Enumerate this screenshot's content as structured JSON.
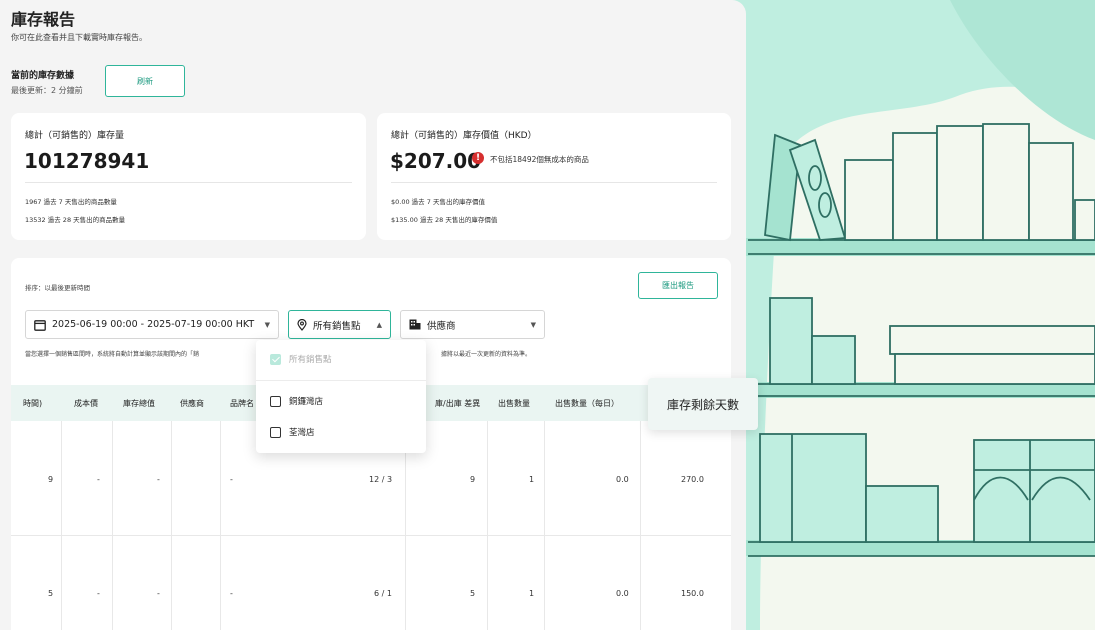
{
  "header": {
    "title": "庫存報告",
    "subtitle": "你可在此查看并且下載實時庫存報告。"
  },
  "current": {
    "title": "當前的庫存數據",
    "updated": "最後更新：2 分鐘前",
    "refresh_label": "刷新"
  },
  "card_quantity": {
    "label": "總計（可銷售的）庫存量",
    "value": "101278941",
    "line1": "1967  過去 7 天售出的商品數量",
    "line2": "13532  過去 28 天售出的商品數量"
  },
  "card_value": {
    "label": "總計（可銷售的）庫存價值（HKD）",
    "value": "$207.00",
    "warning_icon": "!",
    "warning": "不包括18492個無成本的商品",
    "line1": "$0.00  過去 7 天售出的庫存價值",
    "line2": "$135.00  過去 28 天售出的庫存價值"
  },
  "filters": {
    "sort_text": "排序：以最後更新時間",
    "export_label": "匯出報告",
    "date_range": "2025-06-19 00:00 - 2025-07-19 00:00  HKT",
    "location": "所有銷售點",
    "supplier": "供應商",
    "hint_left": "當您選擇一個銷售區間時，系統將自動計算並顯示該期間內的「銷",
    "hint_right": "據將以最近一次更新的資料為準。"
  },
  "dropdown": {
    "items": [
      {
        "label": "所有銷售點",
        "checked": true,
        "disabled": true
      },
      {
        "label": "銅鑼灣店",
        "checked": false
      },
      {
        "label": "荃灣店",
        "checked": false
      }
    ]
  },
  "table": {
    "headers": [
      "時間)",
      "成本價",
      "庫存總值",
      "供應商",
      "品牌名",
      "庫/出庫 差異",
      "出售數量",
      "出售數量（每日）"
    ],
    "rows": [
      [
        "9",
        "-",
        "-",
        "-",
        "12 / 3",
        "9",
        "1",
        "0.0",
        "270.0"
      ],
      [
        "5",
        "-",
        "-",
        "-",
        "6 / 1",
        "5",
        "1",
        "0.0",
        "150.0"
      ]
    ]
  },
  "popout": {
    "label": "庫存剩餘天數"
  },
  "colors": {
    "accent": "#2fb59a",
    "illustration_bg": "#bfeee0",
    "illustration_line": "#2f6f63"
  }
}
